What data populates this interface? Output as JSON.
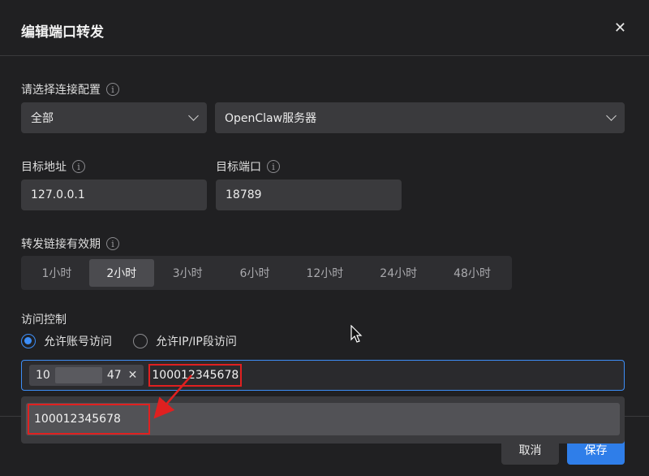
{
  "dialog": {
    "title": "编辑端口转发",
    "close_icon": "close-icon"
  },
  "connection": {
    "label": "请选择连接配置",
    "group_value": "全部",
    "server_value": "OpenClaw服务器"
  },
  "target": {
    "address_label": "目标地址",
    "address_value": "127.0.0.1",
    "port_label": "目标端口",
    "port_value": "18789"
  },
  "validity": {
    "label": "转发链接有效期",
    "options": [
      "1小时",
      "2小时",
      "3小时",
      "6小时",
      "12小时",
      "24小时",
      "48小时"
    ],
    "selected": "2小时"
  },
  "access": {
    "label": "访问控制",
    "radio_account": "允许账号访问",
    "radio_ip": "允许IP/IP段访问",
    "selected": "允许账号访问",
    "tag_prefix": "10",
    "tag_suffix": "47",
    "typed_value": "100012345678",
    "suggestion": "100012345678"
  },
  "footer": {
    "cancel": "取消",
    "save": "保存"
  },
  "colors": {
    "accent": "#2f7ee9",
    "highlight": "#e02020"
  }
}
